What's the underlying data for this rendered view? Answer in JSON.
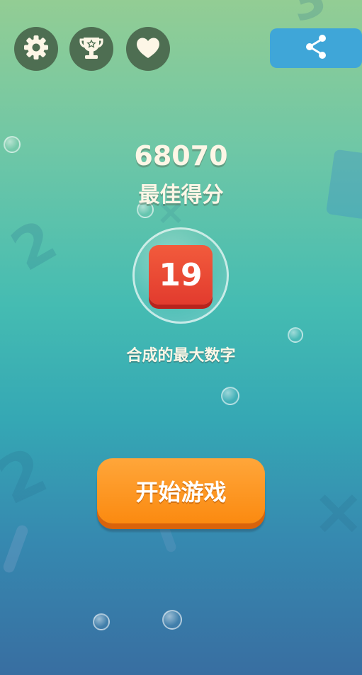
{
  "toolbar": {
    "settings_icon": "gear-icon",
    "leaderboard_icon": "trophy-icon",
    "favorite_icon": "heart-icon",
    "share_icon": "share-icon"
  },
  "best": {
    "score": "68070",
    "label": "最佳得分"
  },
  "max_tile": {
    "value": "19",
    "label": "合成的最大数字"
  },
  "start_button": {
    "label": "开始游戏"
  },
  "colors": {
    "tile": "#e23b2e",
    "start_button": "#fb8a10",
    "share_button": "#3fa6d8",
    "icon_circle": "#4e6e52"
  }
}
